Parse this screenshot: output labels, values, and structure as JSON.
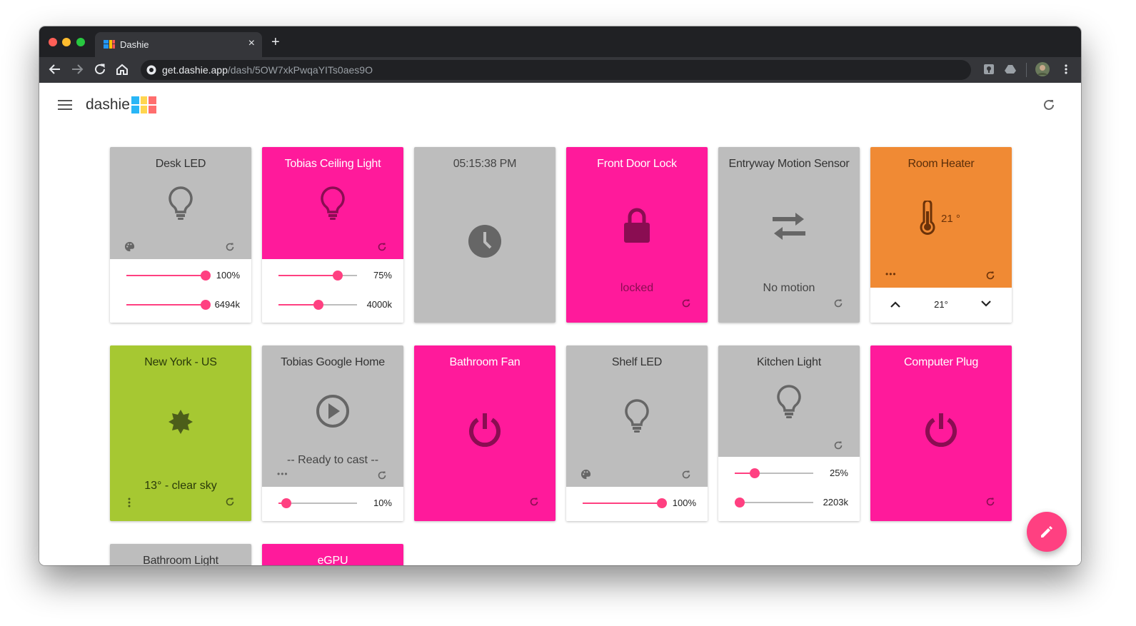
{
  "browser": {
    "tab_title": "Dashie",
    "tab_close": "×",
    "new_tab": "+",
    "url_host": "get.dashie.app",
    "url_path": "/dash/5OW7xkPwqaYITs0aes9O"
  },
  "app": {
    "title": "dashie"
  },
  "colors": {
    "pink": "#ff1a9b",
    "gray": "#bdbdbd",
    "orange": "#f08a34",
    "green": "#a6c832",
    "accent": "#ff4081"
  },
  "tiles": {
    "desk_led": {
      "title": "Desk LED",
      "brightness": "100%",
      "color_temp": "6494k",
      "brightness_level": 100,
      "temp_level": 100
    },
    "tobias_ceiling": {
      "title": "Tobias Ceiling Light",
      "brightness": "75%",
      "color_temp": "4000k",
      "brightness_level": 75,
      "temp_level": 50
    },
    "clock": {
      "title": "05:15:38 PM"
    },
    "front_door": {
      "title": "Front Door Lock",
      "status": "locked"
    },
    "entryway": {
      "title": "Entryway Motion Sensor",
      "status": "No motion"
    },
    "room_heater": {
      "title": "Room Heater",
      "reading": "21 °",
      "setpoint": "21°"
    },
    "new_york": {
      "title": "New York - US",
      "status": "13° - clear sky"
    },
    "google_home": {
      "title": "Tobias Google Home",
      "status": "-- Ready to cast --",
      "volume": "10%",
      "volume_level": 10
    },
    "bathroom_fan": {
      "title": "Bathroom Fan"
    },
    "shelf_led": {
      "title": "Shelf LED",
      "brightness": "100%",
      "brightness_level": 100
    },
    "kitchen_light": {
      "title": "Kitchen Light",
      "brightness": "25%",
      "color_temp": "2203k",
      "brightness_level": 25,
      "temp_level": 0
    },
    "computer_plug": {
      "title": "Computer Plug"
    },
    "bathroom_light": {
      "title": "Bathroom Light"
    },
    "egpu": {
      "title": "eGPU"
    }
  }
}
